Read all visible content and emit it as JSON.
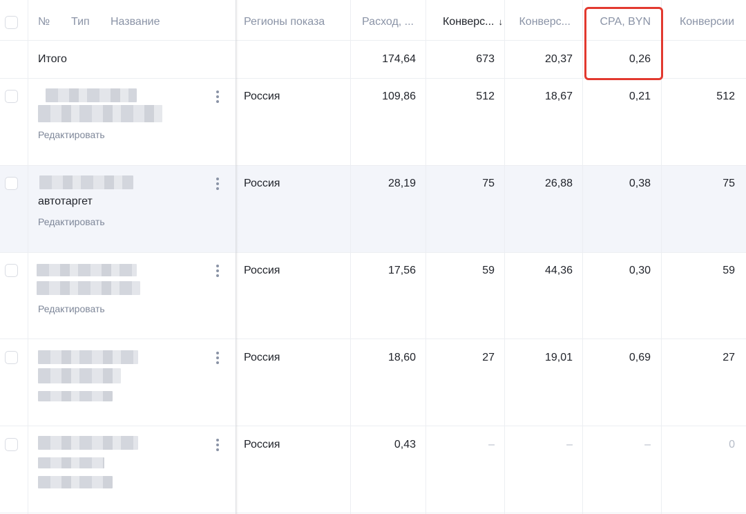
{
  "header": {
    "num": "№",
    "type": "Тип",
    "name": "Название",
    "regions": "Регионы показа",
    "expense": "Расход, ...",
    "conversions_sorted": "Конверс...",
    "sort_arrow": "↓",
    "conversion_rate": "Конверс...",
    "cpa": "CPA, BYN",
    "conversions": "Конверсии"
  },
  "total": {
    "label": "Итого",
    "expense": "174,64",
    "conversions_sorted": "673",
    "conversion_rate": "20,37",
    "cpa": "0,26"
  },
  "rows": [
    {
      "subtitle": "",
      "edit": "Редактировать",
      "region": "Россия",
      "expense": "109,86",
      "conversions_sorted": "512",
      "conversion_rate": "18,67",
      "cpa": "0,21",
      "conversions": "512"
    },
    {
      "subtitle": "автотаргет",
      "edit": "Редактировать",
      "region": "Россия",
      "expense": "28,19",
      "conversions_sorted": "75",
      "conversion_rate": "26,88",
      "cpa": "0,38",
      "conversions": "75"
    },
    {
      "subtitle": "",
      "edit": "Редактировать",
      "region": "Россия",
      "expense": "17,56",
      "conversions_sorted": "59",
      "conversion_rate": "44,36",
      "cpa": "0,30",
      "conversions": "59"
    },
    {
      "subtitle": "",
      "edit": "",
      "region": "Россия",
      "expense": "18,60",
      "conversions_sorted": "27",
      "conversion_rate": "19,01",
      "cpa": "0,69",
      "conversions": "27"
    },
    {
      "subtitle": "",
      "edit": "",
      "region": "Россия",
      "expense": "0,43",
      "conversions_sorted": "–",
      "conversion_rate": "–",
      "cpa": "–",
      "conversions": "0"
    }
  ],
  "colors": {
    "highlight": "#e2392f",
    "row_hover": "#f3f5fa",
    "muted_text": "#8a93a6"
  }
}
